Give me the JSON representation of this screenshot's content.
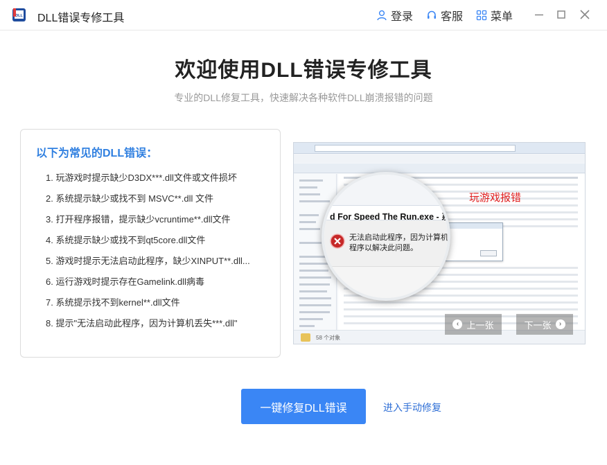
{
  "titlebar": {
    "app_title": "DLL错误专修工具",
    "login": "登录",
    "service": "客服",
    "menu": "菜单"
  },
  "main": {
    "title": "欢迎使用DLL错误专修工具",
    "subtitle": "专业的DLL修复工具，快速解决各种软件DLL崩溃报错的问题"
  },
  "errors": {
    "title": "以下为常见的DLL错误：",
    "items": [
      "1. 玩游戏时提示缺少D3DX***.dll文件或文件损坏",
      "2. 系统提示缺少或找不到 MSVC**.dll 文件",
      "3. 打开程序报错，提示缺少vcruntime**.dll文件",
      "4. 系统提示缺少或找不到qt5core.dll文件",
      "5. 游戏时提示无法启动此程序，缺少XINPUT**.dll...",
      "6. 运行游戏时提示存在Gamelink.dll病毒",
      "7. 系统提示找不到kernel**.dll文件",
      "8. 提示\"无法启动此程序，因为计算机丢失***.dll\""
    ]
  },
  "screenshot": {
    "label": "玩游戏报错",
    "magnifier_caption": "d For Speed The Run.exe - 系统错误",
    "magnifier_msg_line1": "无法启动此程序，因为计算机中丢",
    "magnifier_msg_line2": "程序以解决此问题。",
    "status": "58 个对象",
    "prev": "上一张",
    "next": "下一张"
  },
  "actions": {
    "primary": "一键修复DLL错误",
    "manual": "进入手动修复"
  },
  "colors": {
    "accent": "#3a86f5",
    "panel_title": "#2f7fe0",
    "error_label": "#e02020"
  }
}
